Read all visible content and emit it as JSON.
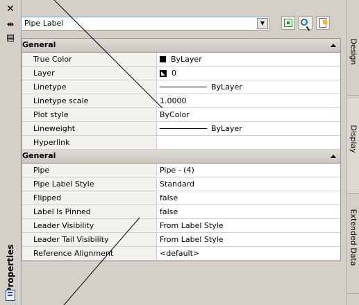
{
  "left_panel": {
    "title": "Properties"
  },
  "selector": {
    "value": "Pipe Label",
    "dropdown_arrow": "chevron-down-icon"
  },
  "toolbar": {
    "buttons": [
      {
        "name": "select-objects-button",
        "icon": "select-objects-icon"
      },
      {
        "name": "quick-select-button",
        "icon": "quick-select-icon"
      },
      {
        "name": "toggle-pickadd-button",
        "icon": "pickadd-icon"
      }
    ]
  },
  "sections": [
    {
      "title": "General",
      "rows": [
        {
          "key": "True Color",
          "value": "ByLayer"
        },
        {
          "key": "Layer",
          "value": "0"
        },
        {
          "key": "Linetype",
          "value": "ByLayer"
        },
        {
          "key": "Linetype scale",
          "value": "1.0000"
        },
        {
          "key": "Plot style",
          "value": "ByColor"
        },
        {
          "key": "Lineweight",
          "value": "ByLayer"
        },
        {
          "key": "Hyperlink",
          "value": ""
        }
      ]
    },
    {
      "title": "General",
      "rows": [
        {
          "key": "Pipe",
          "value": "Pipe - (4)"
        },
        {
          "key": "Pipe Label Style",
          "value": "Standard"
        },
        {
          "key": "Flipped",
          "value": "false"
        },
        {
          "key": "Label Is Pinned",
          "value": "false"
        },
        {
          "key": "Leader Visibility",
          "value": "From Label Style"
        },
        {
          "key": "Leader Tail Visibility",
          "value": "From Label Style"
        },
        {
          "key": "Reference Alignment",
          "value": "<default>"
        }
      ]
    }
  ],
  "right_tabs": [
    {
      "label": "Design"
    },
    {
      "label": "Display"
    },
    {
      "label": "Extended Data"
    }
  ]
}
